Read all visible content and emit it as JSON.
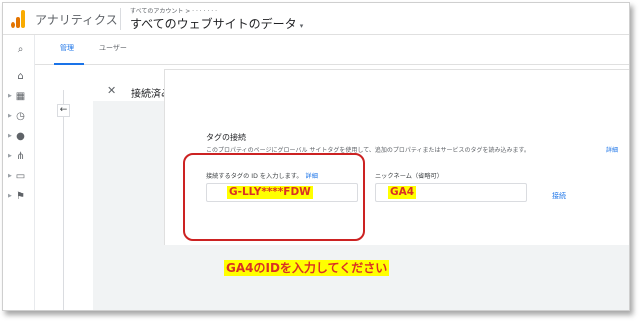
{
  "header": {
    "app_title": "アナリティクス",
    "account_path": "すべてのアカウント > ·  ·  ·  ·  ·  ·  ·",
    "property_title": "すべてのウェブサイトのデータ",
    "caret": "▾"
  },
  "rail": {
    "items": [
      {
        "icon": "search-icon",
        "glyph": "⌕"
      },
      {
        "icon": "home-icon",
        "glyph": "⌂"
      },
      {
        "icon": "dashboard-icon",
        "glyph": "▦"
      },
      {
        "icon": "clock-icon",
        "glyph": "◷"
      },
      {
        "icon": "person-icon",
        "glyph": "●"
      },
      {
        "icon": "share-icon",
        "glyph": "⋔"
      },
      {
        "icon": "window-icon",
        "glyph": "▭"
      },
      {
        "icon": "flag-icon",
        "glyph": "⚑"
      }
    ]
  },
  "tabs": [
    {
      "label": "管理",
      "active": true
    },
    {
      "label": "ユーザー",
      "active": false
    }
  ],
  "panel": {
    "back_glyph": "←",
    "close_glyph": "✕",
    "title": "接続済みのタグ"
  },
  "card": {
    "title": "タグの接続",
    "description": "このプロパティのページにグローバル サイトタグを使用して、追加のプロパティまたはサービスのタグを読み込みます。",
    "description_link": "詳細",
    "id_field": {
      "label": "接続するタグの ID を入力します。",
      "link": "詳細",
      "value": "G-LLY****FDW"
    },
    "nickname_field": {
      "label": "ニックネーム（省略可）",
      "value": "GA4"
    },
    "connect_label": "接続"
  },
  "annotation": {
    "note": "GA4のIDを入力してください",
    "highlight_color": "#ffff00",
    "ring_color": "#cc2222",
    "text_color": "#d93025"
  }
}
